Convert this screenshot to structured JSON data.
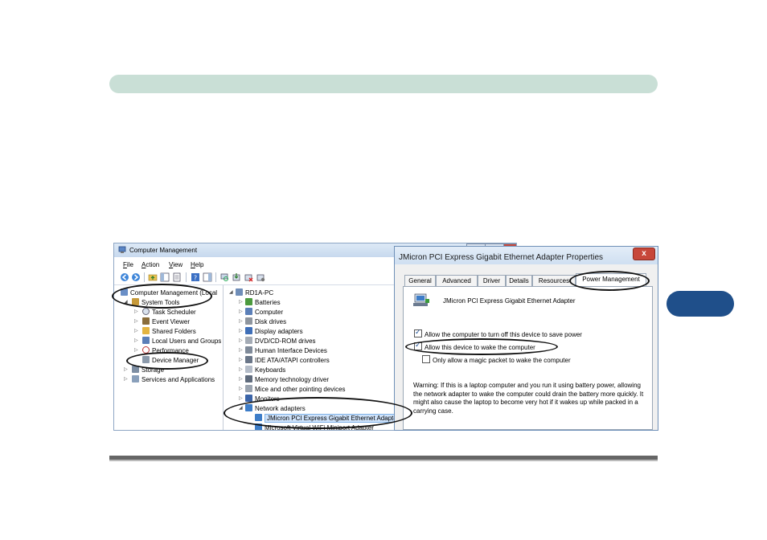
{
  "computer_management": {
    "title": "Computer Management",
    "menu": [
      {
        "key": "F",
        "rest": "ile"
      },
      {
        "key": "A",
        "rest": "ction"
      },
      {
        "key": "V",
        "rest": "iew"
      },
      {
        "key": "H",
        "rest": "elp"
      }
    ],
    "left_tree": {
      "root": "Computer Management (Local",
      "system_tools": "System Tools",
      "items": [
        "Task Scheduler",
        "Event Viewer",
        "Shared Folders",
        "Local Users and Groups",
        "Performance",
        "Device Manager"
      ],
      "storage": "Storage",
      "services": "Services and Applications"
    },
    "device_tree": {
      "root": "RD1A-PC",
      "categories": [
        "Batteries",
        "Computer",
        "Disk drives",
        "Display adapters",
        "DVD/CD-ROM drives",
        "Human Interface Devices",
        "IDE ATA/ATAPI controllers",
        "Keyboards",
        "Memory technology driver",
        "Mice and other pointing devices",
        "Monitors",
        "Network adapters"
      ],
      "network_children": [
        "JMicron PCI Express Gigabit Ethernet Adapter",
        "Microsoft Virtual WiFi Miniport Adapter"
      ]
    }
  },
  "properties_dialog": {
    "title": "JMicron PCI Express Gigabit Ethernet Adapter Properties",
    "close": "x",
    "tabs": [
      "General",
      "Advanced",
      "Driver",
      "Details",
      "Resources",
      "Power Management"
    ],
    "device_name": "JMicron PCI Express Gigabit Ethernet Adapter",
    "options": [
      {
        "label": "Allow the computer to turn off this device to save power",
        "checked": true
      },
      {
        "label": "Allow this device to wake the computer",
        "checked": true
      },
      {
        "label": "Only allow a magic packet to wake the computer",
        "checked": false
      }
    ],
    "warning": "Warning: If this is a laptop computer and you run it using battery power, allowing the network adapter to wake the computer could drain the battery more quickly. It might also cause the laptop to become very hot if it wakes up while packed in a carrying case."
  }
}
